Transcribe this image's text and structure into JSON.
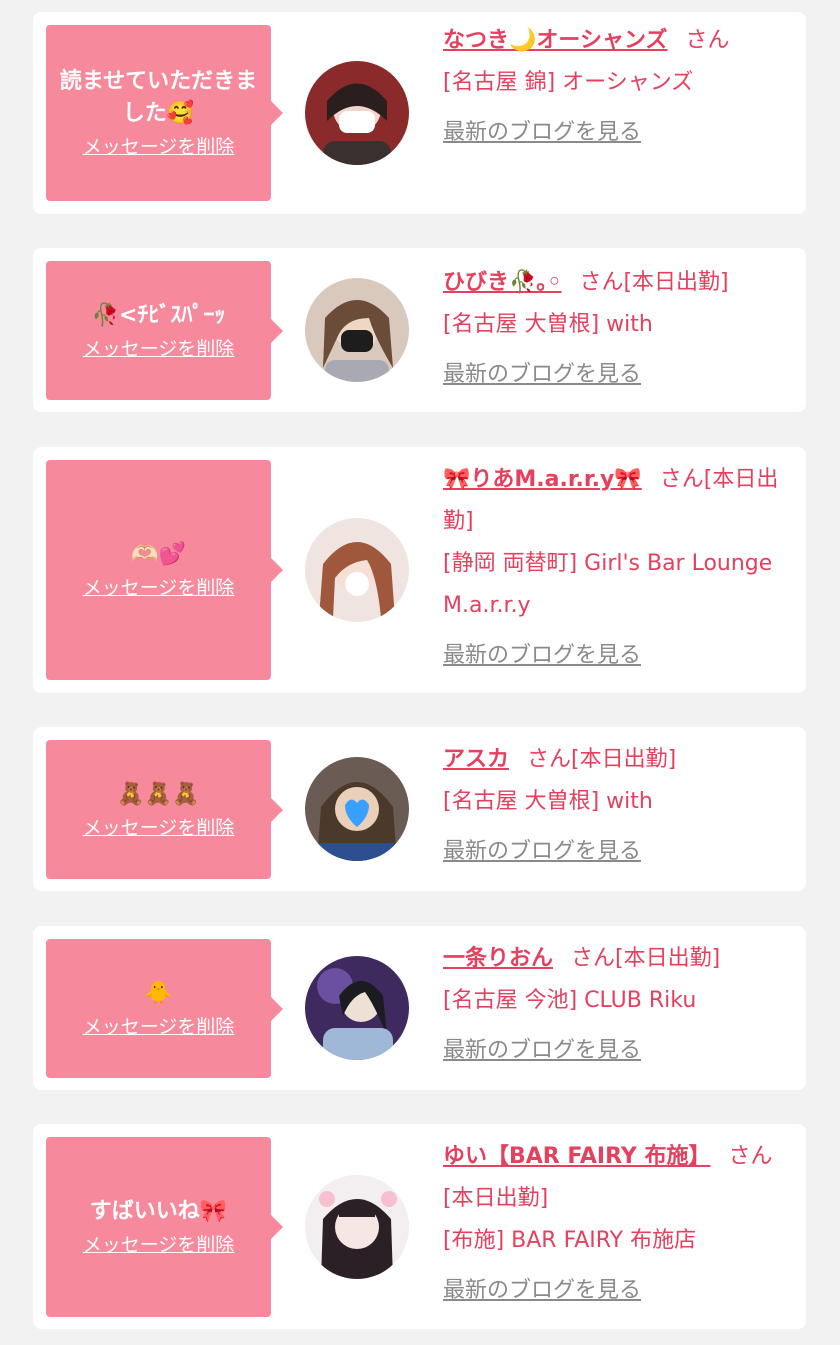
{
  "messages": [
    {
      "text": "読ませていただきました🥰",
      "delete_label": "メッセージを削除",
      "name": "なつき🌙オーシャンズ",
      "suffix": "さん",
      "shop": "[名古屋 錦] オーシャンズ",
      "blog_label": "最新のブログを見る"
    },
    {
      "text": "🥀<ﾁﾋﾞｽﾊﾟｰｯ",
      "delete_label": "メッセージを削除",
      "name": "ひびき🥀｡◦",
      "suffix": "さん[本日出勤]",
      "shop": "[名古屋 大曽根] with",
      "blog_label": "最新のブログを見る"
    },
    {
      "text": "🫶🏻💕",
      "delete_label": "メッセージを削除",
      "name": "🎀りあM.a.r.r.y🎀",
      "suffix": "さん[本日出勤]",
      "shop": "[静岡 両替町] Girl's Bar Lounge M.a.r.r.y",
      "blog_label": "最新のブログを見る"
    },
    {
      "text": "🧸🧸🧸",
      "delete_label": "メッセージを削除",
      "name": "アスカ",
      "suffix": "さん[本日出勤]",
      "shop": "[名古屋 大曽根] with",
      "blog_label": "最新のブログを見る"
    },
    {
      "text": "🐥",
      "delete_label": "メッセージを削除",
      "name": "一条りおん",
      "suffix": "さん[本日出勤]",
      "shop": "[名古屋 今池] CLUB Riku",
      "blog_label": "最新のブログを見る"
    },
    {
      "text": "すばいいね🎀",
      "delete_label": "メッセージを削除",
      "name": "ゆい【BAR FAIRY 布施】",
      "suffix": "さん[本日出勤]",
      "shop": "[布施] BAR FAIRY 布施店",
      "blog_label": "最新のブログを見る"
    }
  ],
  "colors": {
    "bubble": "#f6899c",
    "accent": "#e5405e",
    "link_gray": "#8a8a8a"
  }
}
